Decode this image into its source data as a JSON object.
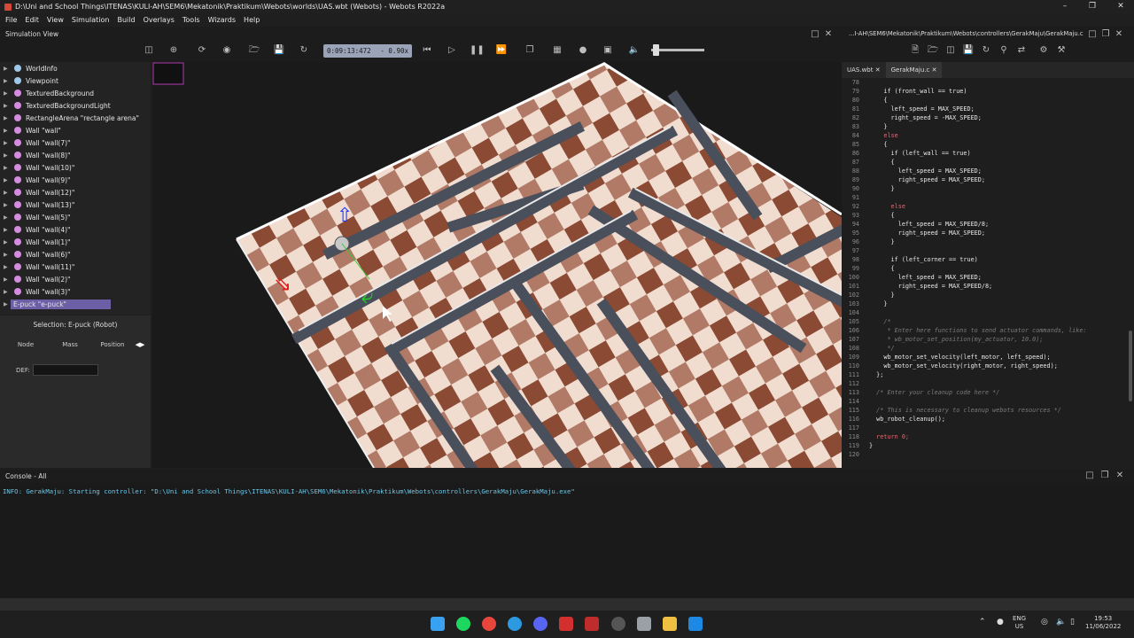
{
  "window": {
    "title": "D:\\Uni and School Things\\ITENAS\\KULI-AH\\SEM6\\Mekatonik\\Praktikum\\Webots\\worlds\\UAS.wbt (Webots) - Webots R2022a"
  },
  "menu": [
    "File",
    "Edit",
    "View",
    "Simulation",
    "Build",
    "Overlays",
    "Tools",
    "Wizards",
    "Help"
  ],
  "simulation_view": {
    "label": "Simulation View",
    "time": "0:09:13:472",
    "speed": "-  0.90x"
  },
  "scene_tree": {
    "items": [
      {
        "label": "WorldInfo",
        "color": "#9ec7e8"
      },
      {
        "label": "Viewpoint",
        "color": "#9ec7e8"
      },
      {
        "label": "TexturedBackground",
        "color": "#d48be0"
      },
      {
        "label": "TexturedBackgroundLight",
        "color": "#d48be0"
      },
      {
        "label": "RectangleArena \"rectangle arena\"",
        "color": "#d48be0"
      },
      {
        "label": "Wall \"wall\"",
        "color": "#d48be0"
      },
      {
        "label": "Wall \"wall(7)\"",
        "color": "#d48be0"
      },
      {
        "label": "Wall \"wall(8)\"",
        "color": "#d48be0"
      },
      {
        "label": "Wall \"wall(10)\"",
        "color": "#d48be0"
      },
      {
        "label": "Wall \"wall(9)\"",
        "color": "#d48be0"
      },
      {
        "label": "Wall \"wall(12)\"",
        "color": "#d48be0"
      },
      {
        "label": "Wall \"wall(13)\"",
        "color": "#d48be0"
      },
      {
        "label": "Wall \"wall(5)\"",
        "color": "#d48be0"
      },
      {
        "label": "Wall \"wall(4)\"",
        "color": "#d48be0"
      },
      {
        "label": "Wall \"wall(1)\"",
        "color": "#d48be0"
      },
      {
        "label": "Wall \"wall(6)\"",
        "color": "#d48be0"
      },
      {
        "label": "Wall \"wall(11)\"",
        "color": "#d48be0"
      },
      {
        "label": "Wall \"wall(2)\"",
        "color": "#d48be0"
      },
      {
        "label": "Wall \"wall(3)\"",
        "color": "#d48be0"
      },
      {
        "label": "E-puck \"e-puck\"",
        "color": "#d48be0"
      }
    ]
  },
  "field_editor": {
    "selection": "Selection: E-puck (Robot)",
    "tabs": [
      "Node",
      "Mass",
      "Position"
    ],
    "def_label": "DEF:"
  },
  "editor": {
    "path": "...I-AH\\SEM6\\Mekatonik\\Praktikum\\Webots\\controllers\\GerakMaju\\GerakMaju.c",
    "tabs": [
      "UAS.wbt",
      "GerakMaju.c"
    ],
    "lines": [
      {
        "n": "78",
        "text": ""
      },
      {
        "n": "79",
        "text": "    if (front_wall == true)"
      },
      {
        "n": "80",
        "text": "    {"
      },
      {
        "n": "81",
        "text": "      left_speed = MAX_SPEED;"
      },
      {
        "n": "82",
        "text": "      right_speed = -MAX_SPEED;"
      },
      {
        "n": "83",
        "text": "    }"
      },
      {
        "n": "84",
        "text": "    else"
      },
      {
        "n": "85",
        "text": "    {"
      },
      {
        "n": "86",
        "text": "      if (left_wall == true)"
      },
      {
        "n": "87",
        "text": "      {"
      },
      {
        "n": "88",
        "text": "        left_speed = MAX_SPEED;"
      },
      {
        "n": "89",
        "text": "        right_speed = MAX_SPEED;"
      },
      {
        "n": "90",
        "text": "      }"
      },
      {
        "n": "91",
        "text": ""
      },
      {
        "n": "92",
        "text": "      else"
      },
      {
        "n": "93",
        "text": "      {"
      },
      {
        "n": "94",
        "text": "        left_speed = MAX_SPEED/8;"
      },
      {
        "n": "95",
        "text": "        right_speed = MAX_SPEED;"
      },
      {
        "n": "96",
        "text": "      }"
      },
      {
        "n": "97",
        "text": ""
      },
      {
        "n": "98",
        "text": "      if (left_corner == true)"
      },
      {
        "n": "99",
        "text": "      {"
      },
      {
        "n": "100",
        "text": "        left_speed = MAX_SPEED;"
      },
      {
        "n": "101",
        "text": "        right_speed = MAX_SPEED/8;"
      },
      {
        "n": "102",
        "text": "      }"
      },
      {
        "n": "103",
        "text": "    }"
      },
      {
        "n": "104",
        "text": ""
      },
      {
        "n": "105",
        "text": "    /*"
      },
      {
        "n": "106",
        "text": "     * Enter here functions to send actuator commands, like:"
      },
      {
        "n": "107",
        "text": "     * wb_motor_set_position(my_actuator, 10.0);"
      },
      {
        "n": "108",
        "text": "     */"
      },
      {
        "n": "109",
        "text": "    wb_motor_set_velocity(left_motor, left_speed);"
      },
      {
        "n": "110",
        "text": "    wb_motor_set_velocity(right_motor, right_speed);"
      },
      {
        "n": "111",
        "text": "  };"
      },
      {
        "n": "112",
        "text": ""
      },
      {
        "n": "113",
        "text": "  /* Enter your cleanup code here */"
      },
      {
        "n": "114",
        "text": ""
      },
      {
        "n": "115",
        "text": "  /* This is necessary to cleanup webots resources */"
      },
      {
        "n": "116",
        "text": "  wb_robot_cleanup();"
      },
      {
        "n": "117",
        "text": ""
      },
      {
        "n": "118",
        "text": "  return 0;"
      },
      {
        "n": "119",
        "text": "}"
      },
      {
        "n": "120",
        "text": ""
      }
    ]
  },
  "console": {
    "label": "Console - All",
    "line": "INFO: GerakMaju: Starting controller: \"D:\\Uni and School Things\\ITENAS\\KULI-AH\\SEM6\\Mekatonik\\Praktikum\\Webots\\controllers\\GerakMaju\\GerakMaju.exe\""
  },
  "taskbar": {
    "lang": "ENG",
    "region": "US",
    "time": "19:53",
    "date": "11/06/2022"
  }
}
